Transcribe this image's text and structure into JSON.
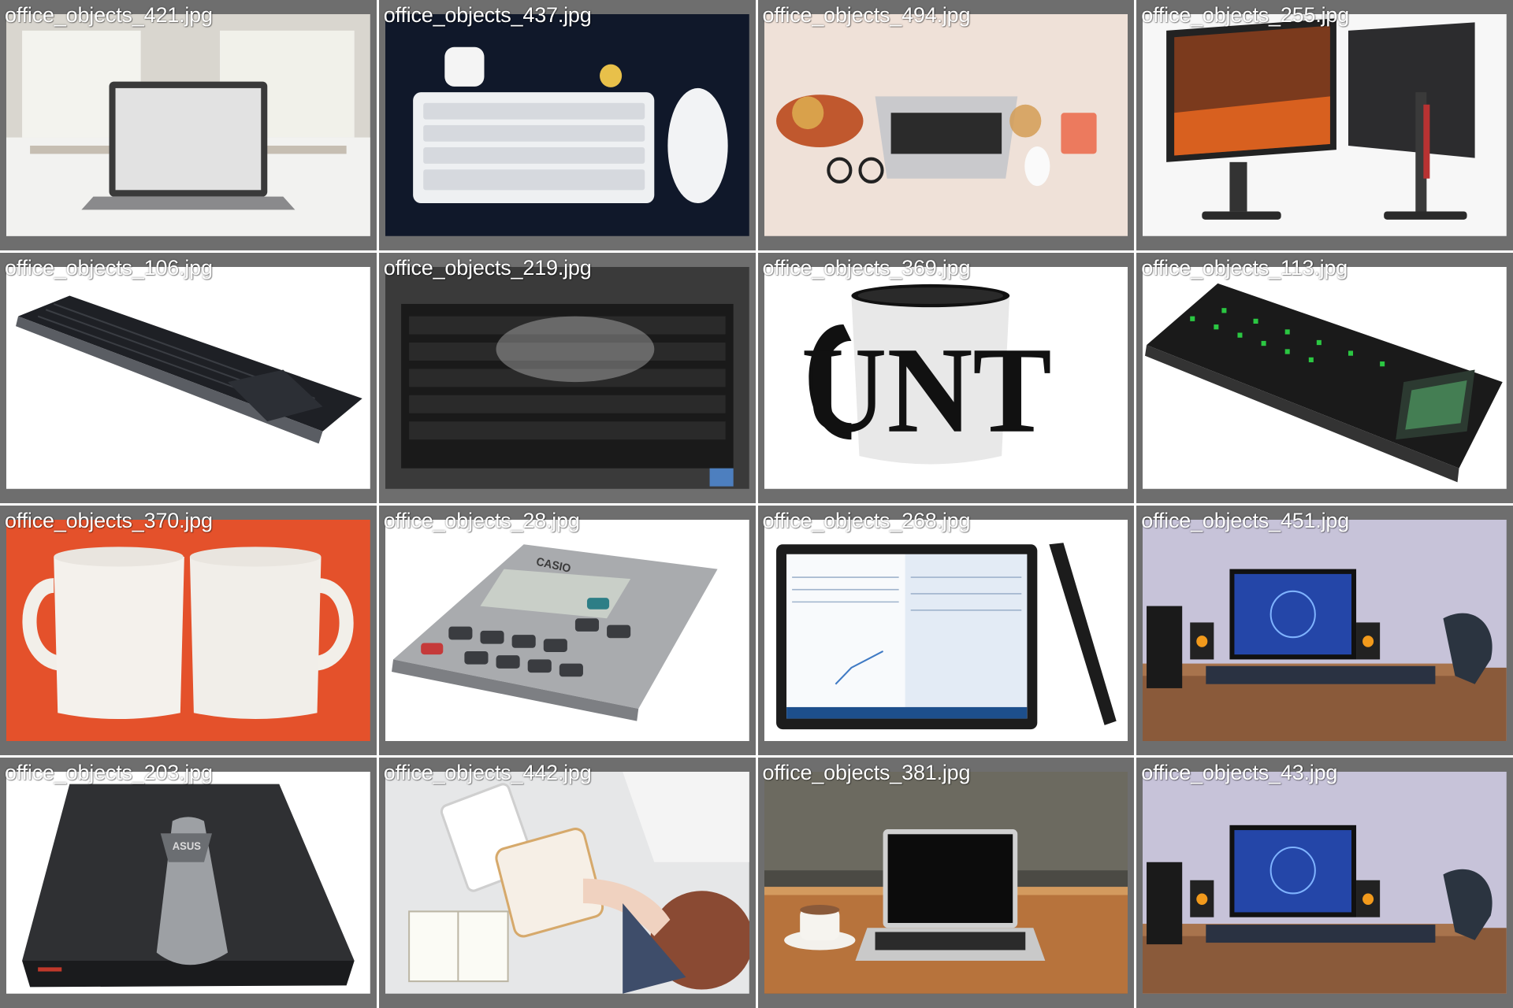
{
  "gallery": {
    "images": [
      {
        "filename": "office_objects_421.jpg",
        "subject": "laptop-on-table"
      },
      {
        "filename": "office_objects_437.jpg",
        "subject": "keyboard-mouse-airpods"
      },
      {
        "filename": "office_objects_494.jpg",
        "subject": "desk-flatlay-laptop"
      },
      {
        "filename": "office_objects_255.jpg",
        "subject": "dual-monitors"
      },
      {
        "filename": "office_objects_106.jpg",
        "subject": "wireless-keyboard"
      },
      {
        "filename": "office_objects_219.jpg",
        "subject": "laptop-keyboard-closeup"
      },
      {
        "filename": "office_objects_369.jpg",
        "subject": "printed-mug"
      },
      {
        "filename": "office_objects_113.jpg",
        "subject": "gaming-keyboard"
      },
      {
        "filename": "office_objects_370.jpg",
        "subject": "two-white-mugs"
      },
      {
        "filename": "office_objects_28.jpg",
        "subject": "calculator"
      },
      {
        "filename": "office_objects_268.jpg",
        "subject": "tablet-with-stand"
      },
      {
        "filename": "office_objects_451.jpg",
        "subject": "gaming-desk-setup"
      },
      {
        "filename": "office_objects_203.jpg",
        "subject": "laptop-lid"
      },
      {
        "filename": "office_objects_442.jpg",
        "subject": "person-typing-tablet"
      },
      {
        "filename": "office_objects_381.jpg",
        "subject": "laptop-and-coffee"
      },
      {
        "filename": "office_objects_43.jpg",
        "subject": "gaming-desk-setup"
      }
    ]
  },
  "photo_text": {
    "mug": "UNT",
    "calculator_brand": "CASIO",
    "laptop_brand": "ASUS"
  },
  "colors": {
    "tile_frame": "#6e6e6e",
    "gutter": "#ffffff",
    "label": "#ffffff"
  }
}
